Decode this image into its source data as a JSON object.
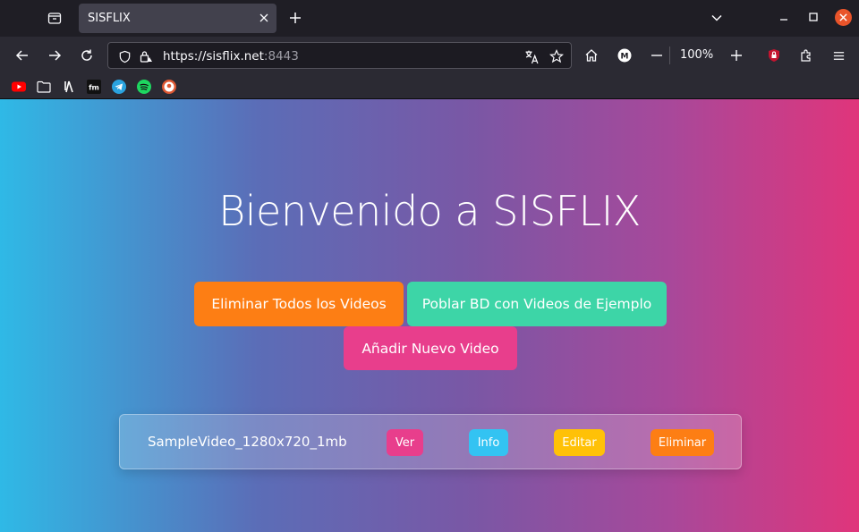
{
  "browser": {
    "tab_title": "SISFLIX",
    "url_host": "https://sisflix.net",
    "url_port": ":8443",
    "zoom": "100%"
  },
  "page": {
    "title": "Bienvenido a SISFLIX",
    "buttons": {
      "delete_all": "Eliminar Todos los Videos",
      "populate": "Poblar BD con Videos de Ejemplo",
      "add": "Añadir Nuevo Video"
    },
    "videos": [
      {
        "name": "SampleVideo_1280x720_1mb",
        "actions": {
          "view": "Ver",
          "info": "Info",
          "edit": "Editar",
          "delete": "Eliminar"
        }
      }
    ]
  },
  "colors": {
    "orange": "#fd7e14",
    "teal": "#3dd5a7",
    "pink": "#e83e8c",
    "cyan": "#33c3f2",
    "yellow": "#ffc107"
  }
}
